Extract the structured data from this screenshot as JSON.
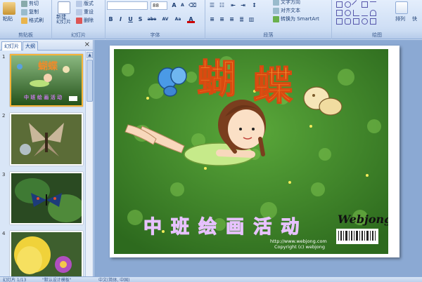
{
  "ribbon": {
    "clipboard": {
      "group_label": "剪贴板",
      "paste_label": "粘贴",
      "cut_label": "剪切",
      "copy_label": "复制",
      "format_painter_label": "格式刷"
    },
    "slides": {
      "group_label": "幻灯片",
      "new_slide_label": "新建\n幻灯片",
      "layout_label": "版式",
      "reset_label": "重设",
      "delete_label": "删除"
    },
    "font": {
      "group_label": "字体",
      "font_name": "",
      "font_size": "88",
      "bold": "B",
      "italic": "I",
      "underline": "U",
      "shadow": "S",
      "strike": "abe",
      "spacing": "AV",
      "case": "Aa",
      "color": "A"
    },
    "paragraph": {
      "group_label": "段落",
      "text_direction": "文字方向",
      "align_text": "对齐文本",
      "smartart": "转换为 SmartArt"
    },
    "drawing": {
      "group_label": "绘图",
      "arrange_label": "排列",
      "quick_label": "快"
    }
  },
  "left_panel": {
    "tab_slides": "幻灯片",
    "tab_outline": "大纲",
    "close_glyph": "×",
    "thumbnails": [
      {
        "number": "1",
        "selected": true
      },
      {
        "number": "2",
        "selected": false
      },
      {
        "number": "3",
        "selected": false
      },
      {
        "number": "4",
        "selected": false
      }
    ]
  },
  "slide": {
    "title_char_1": "蝴",
    "title_char_2": "蝶",
    "subtitle": "中 班 绘 画 活 动",
    "watermark_line1": "http://www.webjong.com",
    "watermark_line2": "Copyright (c) webjong",
    "logo_text": "Webjong"
  },
  "statusbar": {
    "slide_count": "幻灯片 1/13",
    "theme": "\"默认设计模板\"",
    "language": "中文(简体, 中国)"
  },
  "colors": {
    "selected_border": "#f5b338",
    "subtitle": "#8b1fd6",
    "title_orange": "#f07c1a"
  }
}
